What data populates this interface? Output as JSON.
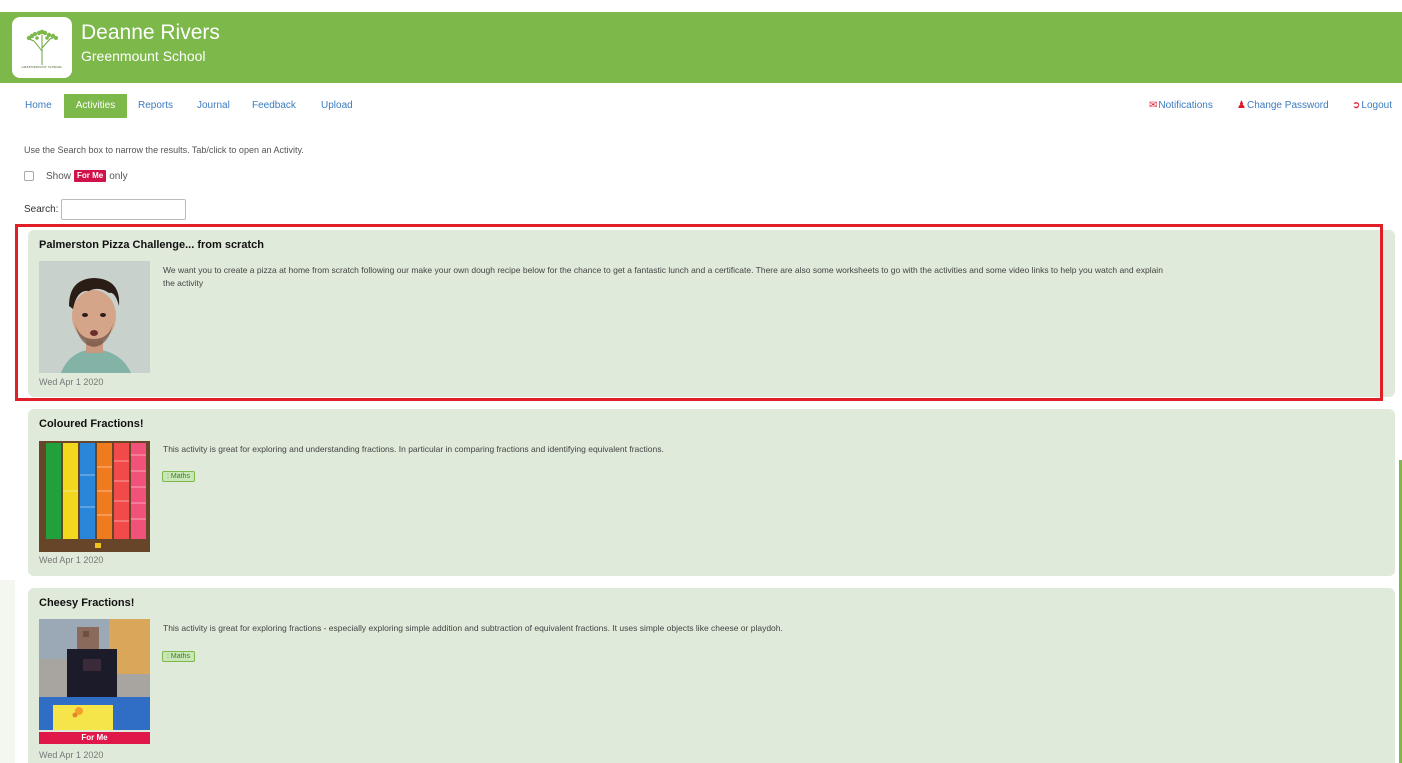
{
  "header": {
    "user_name": "Deanne Rivers",
    "school_name": "Greenmount School",
    "logo_text": "GREENMOUNT SCHOOL",
    "brand_color": "#7db84a"
  },
  "nav": {
    "left": [
      "Home",
      "Activities",
      "Reports",
      "Journal",
      "Feedback",
      "Upload"
    ],
    "active": "Activities",
    "right": [
      {
        "label": "Notifications",
        "icon": "envelope-icon"
      },
      {
        "label": "Change Password",
        "icon": "user-icon"
      },
      {
        "label": "Logout",
        "icon": "logout-icon"
      }
    ]
  },
  "intro": "Use the Search box to narrow the results. Tab/click to open an Activity.",
  "filter": {
    "show_label": "Show",
    "badge": "For Me",
    "only_label": "only",
    "checked": false
  },
  "search": {
    "label": "Search:",
    "value": ""
  },
  "activities": [
    {
      "title": "Palmerston Pizza Challenge... from scratch",
      "description": "We want you to create a pizza at home from scratch following our make your own dough recipe below for the chance to get a fantastic lunch and a certificate. There are also some worksheets to go with the activities and some video links to help you watch and explain the activity",
      "date": "Wed Apr 1 2020",
      "tag": "",
      "for_me": false,
      "highlighted": true
    },
    {
      "title": "Coloured Fractions!",
      "description": "This activity is great for exploring and understanding fractions. In particular in comparing fractions and identifying equivalent fractions.",
      "date": "Wed Apr 1 2020",
      "tag": ": Maths",
      "for_me": false,
      "highlighted": false
    },
    {
      "title": "Cheesy Fractions!",
      "description": "This activity is great for exploring fractions - especially exploring simple addition and subtraction of equivalent fractions. It uses simple objects like cheese or playdoh.",
      "date": "Wed Apr 1 2020",
      "tag": ": Maths",
      "for_me": true,
      "for_me_label": "For Me",
      "highlighted": false
    }
  ]
}
